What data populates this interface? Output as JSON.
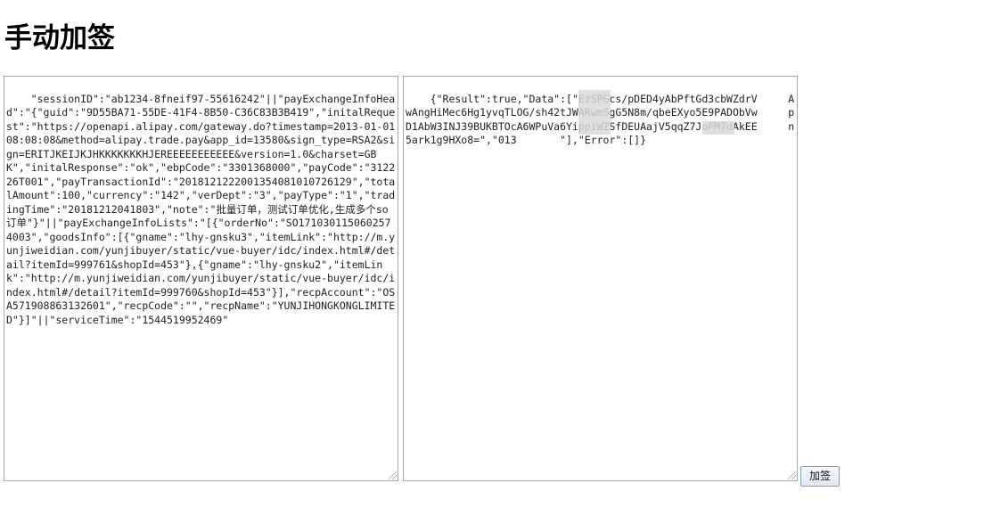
{
  "page": {
    "title": "手动加签"
  },
  "request_editor": {
    "value": "\"sessionID\":\"ab1234-8fneif97-55616242\"||\"payExchangeInfoHead\":\"{\"guid\":\"9D55BA71-55DE-41F4-8B50-C36C83B3B419\",\"initalRequest\":\"https://openapi.alipay.com/gateway.do?timestamp=2013-01-0108:08:08&method=alipay.trade.pay&app_id=13580&sign_type=RSA2&sign=ERITJKEIJKJHKKKKKKKHJEREEEEEEEEEEE&version=1.0&charset=GBK\",\"initalResponse\":\"ok\",\"ebpCode\":\"3301368000\",\"payCode\":\"312226T001\",\"payTransactionId\":\"2018121222001354081010726129\",\"totalAmount\":100,\"currency\":\"142\",\"verDept\":\"3\",\"payType\":\"1\",\"tradingTime\":\"20181212041803\",\"note\":\"批量订单，测试订单优化,生成多个so订单\"}\"||\"payExchangeInfoLists\":\"[{\"orderNo\":\"SO1710301150602574003\",\"goodsInfo\":[{\"gname\":\"lhy-gnsku3\",\"itemLink\":\"http://m.yunjiweidian.com/yunjibuyer/static/vue-buyer/idc/index.html#/detail?itemId=999761&shopId=453\"},{\"gname\":\"lhy-gnsku2\",\"itemLink\":\"http://m.yunjiweidian.com/yunjibuyer/static/vue-buyer/idc/index.html#/detail?itemId=999760&shopId=453\"}],\"recpAccount\":\"OSA571908863132601\",\"recpCode\":\"\",\"recpName\":\"YUNJIHONGKONGLIMITED\"}]\"||\"serviceTime\":\"1544519952469\""
  },
  "result_editor": {
    "value": "{\"Result\":true,\"Data\":[\"EzSPGcs/pDED4yAbPftGd3cbWZdrV     AwAngHiMec6Hg1yvqTLOG/sh42tJWARwmSgG5N8m/qbeEXyo5E9PADObVw     pD1AbW3INJ39BUKBTOcA6WPuVa6YippiWZSfDEUAajV5qqZ7JoFM7dAkEE     n5ark1g9HXo8=\",\"013       \"],\"Error\":[]}"
  },
  "sign_button": {
    "label": "加签"
  }
}
